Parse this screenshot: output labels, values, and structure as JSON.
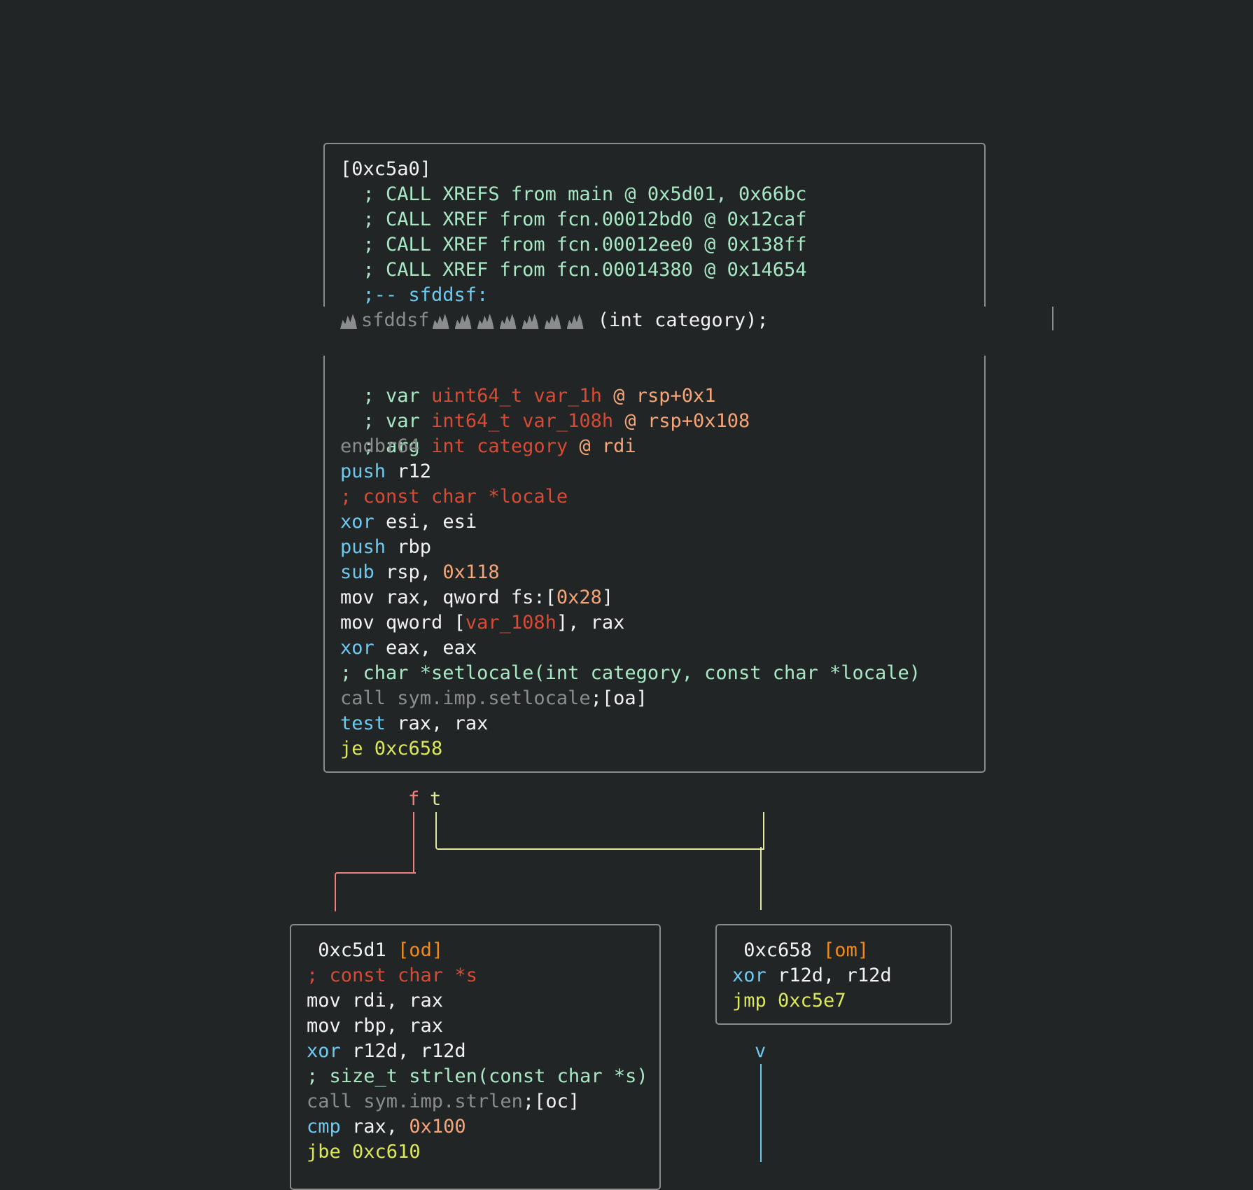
{
  "colors": {
    "background": "#212526",
    "box_border": "#8a8c8c",
    "text": "#f2f2f2",
    "comment": "#a8e8c4",
    "mnemonic": "#6ec9ee",
    "dim": "#8b8d8d",
    "type_red": "#d84a34",
    "number": "#f5a578",
    "jump": "#dce857",
    "tag": "#f08a1c",
    "edge_false": "#f27f7f",
    "edge_true": "#e2e89c",
    "edge_down": "#6ec9ee"
  },
  "main_block": {
    "address": "[0xc5a0]",
    "xrefs": [
      "  ; CALL XREFS from main @ 0x5d01, 0x66bc",
      "  ; CALL XREF from fcn.00012bd0 @ 0x12caf",
      "  ; CALL XREF from fcn.00012ee0 @ 0x138ff",
      "  ; CALL XREF from fcn.00014380 @ 0x14654"
    ],
    "label": "  ;-- sfddsf:",
    "signature_name": "sfddsf",
    "signature_params": " (int category);",
    "vars": [
      {
        "kw": "; var ",
        "type": "uint64_t var_1h",
        "at": " @ ",
        "loc": "rsp+0x1"
      },
      {
        "kw": "; var ",
        "type": "int64_t var_108h",
        "at": " @ ",
        "loc": "rsp+0x108"
      },
      {
        "kw": "; arg ",
        "type": "int category",
        "at": " @ ",
        "loc": "rdi"
      }
    ],
    "endbr": "endbr64",
    "push_r12": {
      "op": "push",
      "args": " r12"
    },
    "locale_comment": "; const char *locale",
    "xor_esi": {
      "op": "xor",
      "args": " esi, esi"
    },
    "push_rbp": {
      "op": "push",
      "args": " rbp"
    },
    "sub_rsp": {
      "op": "sub",
      "args": " rsp, ",
      "num": "0x118"
    },
    "mov_rax": {
      "pre": "mov rax, qword fs:[",
      "num": "0x28",
      "post": "]"
    },
    "mov_qword": {
      "pre": "mov qword [",
      "var": "var_108h",
      "post": "], rax"
    },
    "xor_eax": {
      "op": "xor",
      "args": " eax, eax"
    },
    "setlocale_comment": "; char *setlocale(int category, const char *locale)",
    "call_setlocale": {
      "op": "call sym.imp.setlocale",
      "tag": ";[oa]"
    },
    "test_rax": {
      "op": "test",
      "args": " rax, rax"
    },
    "je": {
      "op": "je",
      "target": " 0xc658"
    }
  },
  "edges": {
    "false_label": "f",
    "true_label": "t",
    "down_label": "v"
  },
  "block_left": {
    "address": " 0xc5d1",
    "tag": " [od]",
    "comment_s": "; const char *s",
    "mov_rdi": "mov rdi, rax",
    "mov_rbp": "mov rbp, rax",
    "xor_r12": {
      "op": "xor",
      "args": " r12d, r12d"
    },
    "strlen_comment": "; size_t strlen(const char *s)",
    "call_strlen": {
      "op": "call sym.imp.strlen",
      "tag": ";[oc]"
    },
    "cmp": {
      "op": "cmp",
      "args": " rax, ",
      "num": "0x100"
    },
    "jbe": {
      "op": "jbe",
      "target": " 0xc610"
    }
  },
  "block_right": {
    "address": " 0xc658",
    "tag": " [om]",
    "xor_r12": {
      "op": "xor",
      "args": " r12d, r12d"
    },
    "jmp": {
      "op": "jmp",
      "target": " 0xc5e7"
    }
  }
}
